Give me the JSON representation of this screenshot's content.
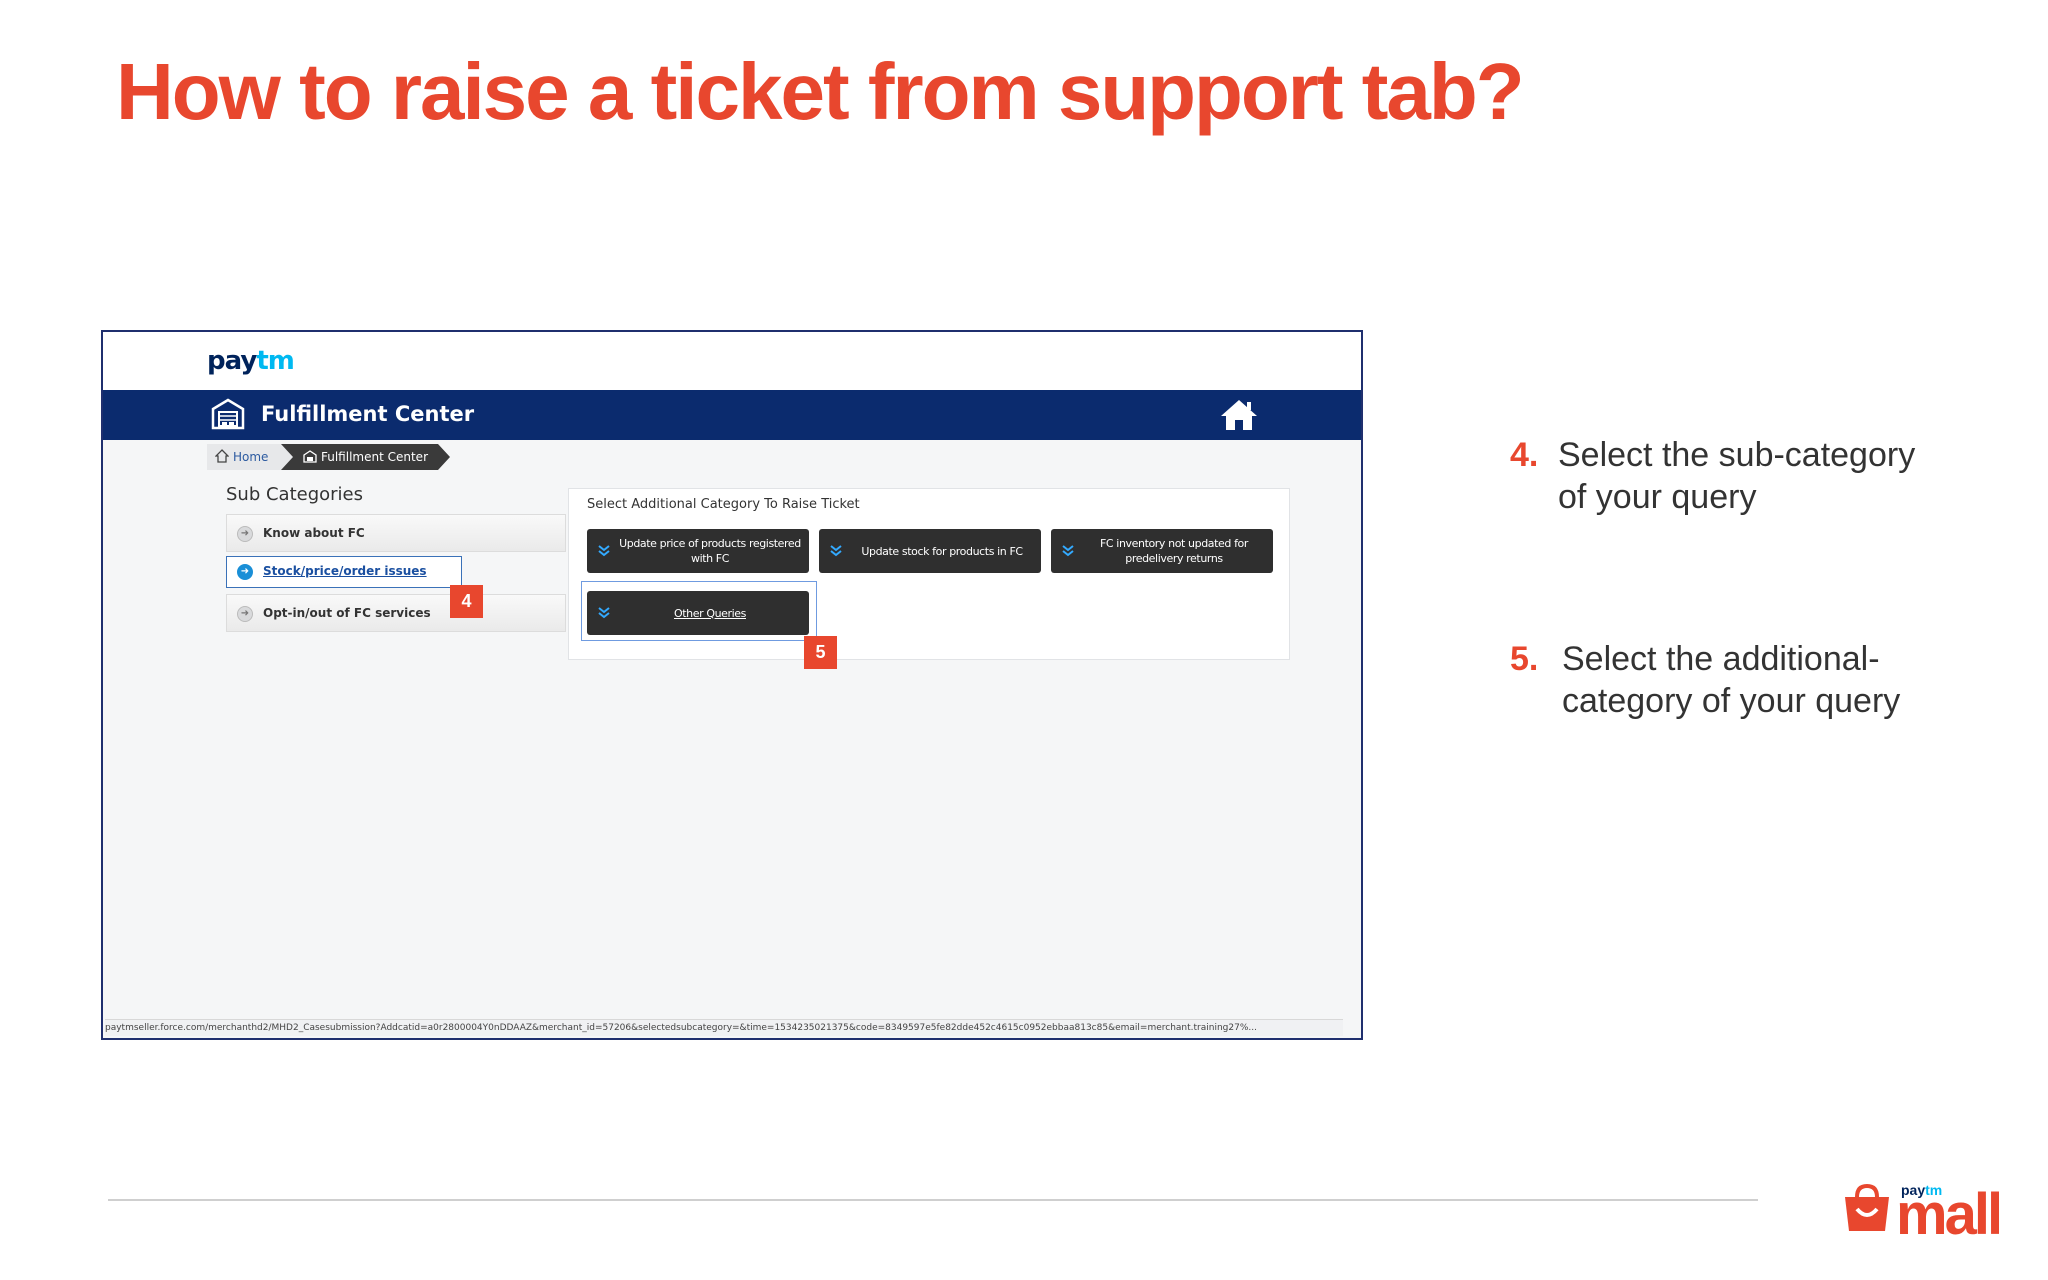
{
  "slide": {
    "title": "How to raise a ticket from support tab?"
  },
  "app": {
    "logo_brand": "pay",
    "logo_brand_suffix": "tm",
    "nav_title": "Fulfillment Center",
    "breadcrumb": {
      "home": "Home",
      "current": "Fulfillment Center"
    },
    "sub_categories": {
      "title": "Sub Categories",
      "items": [
        {
          "label": "Know about FC",
          "active": false
        },
        {
          "label": "Stock/price/order issues",
          "active": true
        },
        {
          "label": "Opt-in/out of FC services",
          "active": false
        }
      ]
    },
    "additional_category": {
      "heading": "Select Additional Category To Raise Ticket",
      "buttons": [
        {
          "label": "Update price of products registered with FC",
          "selected": false
        },
        {
          "label": "Update stock for products in FC",
          "selected": false
        },
        {
          "label": "FC inventory not updated for predelivery returns",
          "selected": false
        },
        {
          "label": "Other Queries",
          "selected": true
        }
      ]
    },
    "status_url": "paytmseller.force.com/merchanthd2/MHD2_Casesubmission?Addcatid=a0r2800004Y0nDDAAZ&merchant_id=57206&selectedsubcategory=&time=1534235021375&code=8349597e5fe82dde452c4615c0952ebbaa813c85&email=merchant.training27%..."
  },
  "markers": {
    "step4": "4",
    "step5": "5"
  },
  "steps": [
    {
      "number": "4.",
      "text_line1": "Select the sub-category",
      "text_line2": "of your query"
    },
    {
      "number": "5.",
      "text_line1": "Select the additional-",
      "text_line2": "category of your query"
    }
  ],
  "footer_logo": {
    "small_prefix": "pay",
    "small_suffix": "tm",
    "big": "mall"
  },
  "colors": {
    "accent": "#e8472e",
    "nav": "#0b2b6e",
    "button": "#2f2f2f",
    "link": "#1a4fa0"
  },
  "icons": [
    "warehouse-icon",
    "home-icon",
    "arrow-circle-icon",
    "chevron-down-icon",
    "shopping-bag-icon"
  ]
}
